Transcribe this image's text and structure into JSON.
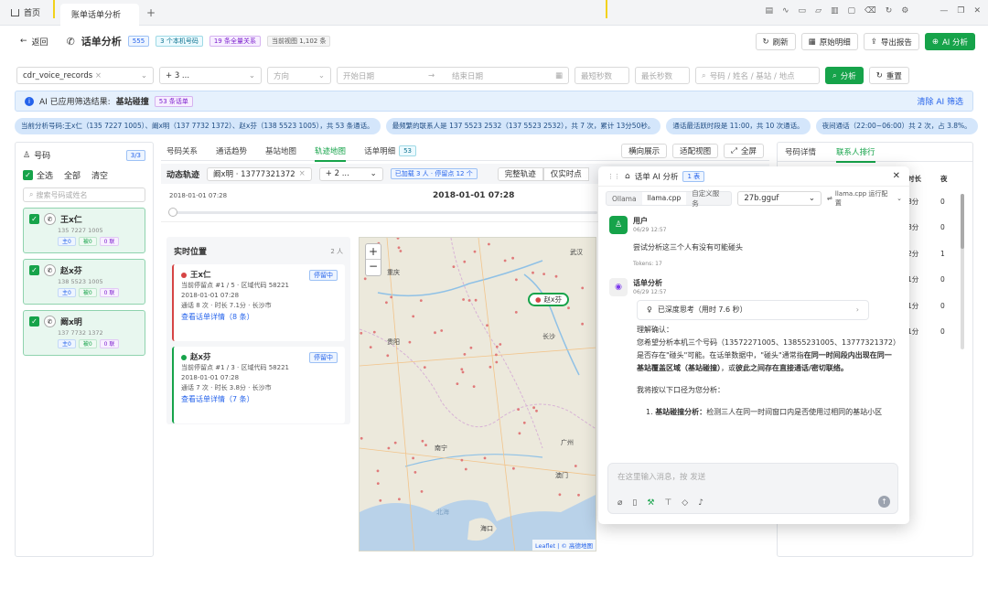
{
  "tabs": {
    "home": "首页",
    "current": "账单话单分析",
    "add": "+"
  },
  "header": {
    "back": "返回",
    "title": "话单分析",
    "count_tag": "555",
    "numbers_tag": "3 个本机号码",
    "relations_tag": "19 条全量关系",
    "records_label": "当前视图 1,102 条",
    "actions": {
      "refresh": "刷新",
      "details": "原始明细",
      "export": "导出报告",
      "ai": "AI 分析"
    }
  },
  "filters": {
    "table": "cdr_voice_records",
    "number_ph": "+ 3 ...",
    "direction_ph": "方向",
    "start_ph": "开始日期",
    "end_ph": "结束日期",
    "min_sec_ph": "最短秒数",
    "max_sec_ph": "最长秒数",
    "search_ph": "号码 / 姓名 / 基站 / 地点",
    "analyze": "分析",
    "reset": "重置"
  },
  "banner": {
    "text": "AI 已应用筛选结果:",
    "highlight": "基站碰撞",
    "count_tag": "53 条话单",
    "clear": "清除 AI 筛选"
  },
  "insights": [
    "当前分析号码:王x仁（135 7227 1005）、阚x明（137 7732 1372）、赵x芬（138 5523 1005），共 53 条通话。",
    "最频繁的联系人是 137 5523 2532（137 5523 2532），共 7 次，累计 13分50秒。",
    "通话最活跃时段是 11:00，共 10 次通话。",
    "夜间通话（22:00~06:00）共 2 次，占 3.8%。"
  ],
  "left": {
    "title": "号码",
    "count": "3/3",
    "all": "全选",
    "all2": "全部",
    "clear": "清空",
    "search_ph": "搜索号码或姓名",
    "persons": [
      {
        "name": "王x仁",
        "phone": "135 7227 1005",
        "b1": "主0",
        "b2": "被0",
        "b3": "0 联"
      },
      {
        "name": "赵x芬",
        "phone": "138 5523 1005",
        "b1": "主0",
        "b2": "被0",
        "b3": "0 联"
      },
      {
        "name": "阚x明",
        "phone": "137 7732 1372",
        "b1": "主0",
        "b2": "被0",
        "b3": "0 联"
      }
    ]
  },
  "center": {
    "tabs": [
      "号码关系",
      "通话趋势",
      "基站地图",
      "轨迹地图",
      "话单明细"
    ],
    "tab_count": "53",
    "fit": "横向展示",
    "view": "适配视图",
    "full": "全屏",
    "track": {
      "title": "动态轨迹",
      "sel": "阚x明 · 13777321372",
      "more": "+ 2 ...",
      "loaded": "已加载 3 人 · 停留点 12 个",
      "full_track": "完整轨迹",
      "only_stay": "仅实时点",
      "start": "2018-01-01 07:28",
      "current": "2018-01-01 07:28"
    },
    "realtime": {
      "title": "实时位置",
      "count": "2 人",
      "items": [
        {
          "name": "王x仁",
          "status": "停留中",
          "line1": "当前停留点 #1 / 5 · 区域代码 58221",
          "line2": "2018-01-01 07:28",
          "line3": "通话 8 次 · 时长 7.1分 · 长沙市",
          "link": "查看话单详情（8 条）",
          "color": "#d64545"
        },
        {
          "name": "赵x芬",
          "status": "停留中",
          "line1": "当前停留点 #1 / 3 · 区域代码 58221",
          "line2": "2018-01-01 07:28",
          "line3": "通话 7 次 · 时长 3.8分 · 长沙市",
          "link": "查看话单详情（7 条）",
          "color": "#16a34a"
        }
      ]
    },
    "map": {
      "marker": "赵x芬",
      "attrib": "Leaflet | © 高德地图",
      "cities": [
        "重庆",
        "长沙",
        "贵阳",
        "南宁",
        "广州",
        "澳门",
        "海口",
        "武汉",
        "北海"
      ]
    }
  },
  "right": {
    "tabs": [
      "号码详情",
      "联系人排行"
    ],
    "cols": [
      "时长",
      "夜"
    ],
    "rows": [
      [
        "8分",
        "0"
      ],
      [
        "8分",
        "0"
      ],
      [
        "2分",
        "1"
      ],
      [
        "1分",
        "0"
      ],
      [
        "1分",
        "0"
      ],
      [
        "1分",
        "0"
      ]
    ]
  },
  "ai": {
    "title": "话单 AI 分析",
    "count": "1 表",
    "tabs": [
      "Ollama",
      "llama.cpp",
      "自定义服务"
    ],
    "model": "27b.gguf",
    "config": "llama.cpp 运行配置",
    "user": {
      "name": "用户",
      "time": "06/29 12:57",
      "msg": "尝试分析这三个人有没有可能碰头",
      "tokens": "Tokens: 17"
    },
    "bot": {
      "name": "话单分析",
      "time": "06/29 12:57",
      "think": "已深度思考（用时 7.6 秒）",
      "p1": "理解确认：",
      "p2a": "您希望分析本机三个号码（13572271005、13855231005、13777321372）是否存在\"碰头\"可能。在话单数据中，\"碰头\"通常指",
      "p2b": "在同一时间段内出现在同一基站覆盖区域（基站碰撞）",
      "p2c": "，或",
      "p2d": "彼此之间存在直接通话/密切联络。",
      "p3": "我将按以下口径为您分析：",
      "li_b": "基站碰撞分析：",
      "li": "检测三人在同一时间窗口内是否使用过相同的基站小区"
    },
    "input_ph": "在这里输入消息，按 发送"
  },
  "colors": {
    "accent": "#16a34a",
    "banner": "#e6f1fd",
    "link": "#2563eb"
  }
}
